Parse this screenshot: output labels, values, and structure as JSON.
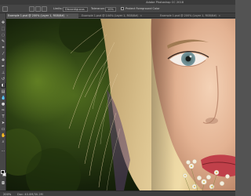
{
  "app": {
    "title": "Adobe Photoshop CC 2018"
  },
  "options_bar": {
    "sample_label": "Limits:",
    "limits_value": "Discontiguous",
    "tolerance_label": "Tolerance:",
    "tolerance_value": "10%",
    "protect_label": "Protect Foreground Color"
  },
  "tabs": [
    {
      "label": "Example 1.psd @ 200% (Layer 1, RGB/8#)",
      "active": true
    },
    {
      "label": "Example 1.psd @ 144% (Layer 1, RGB/8#)",
      "active": false
    },
    {
      "label": "Example 1.psd @ 200% (Layer 1, RGB/8#)",
      "active": false
    }
  ],
  "status": {
    "zoom": "200%",
    "doc": "Doc: 40.0M/30.2M"
  },
  "colors": {
    "foreground": "#000000",
    "background": "#ffffff"
  }
}
